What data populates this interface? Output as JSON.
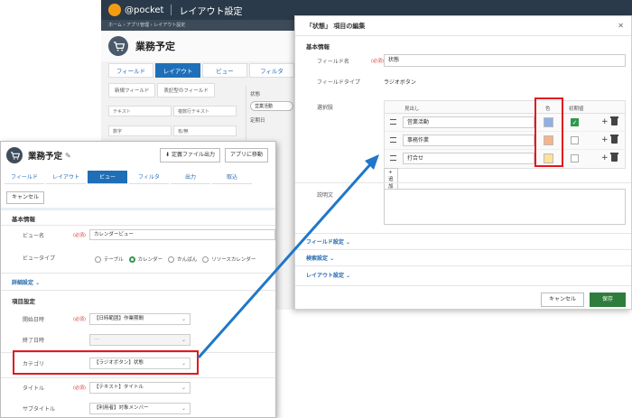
{
  "bg_app": {
    "logo": "@pocket",
    "title": "レイアウト設定",
    "breadcrumb": "ホーム › アプリ管理 › レイアウト設定",
    "page_title": "業務予定",
    "tabs": [
      "フィールド",
      "レイアウト",
      "ビュー",
      "フィルタ"
    ],
    "sub_tabs": [
      "新規フィールド",
      "表記型のフィールド"
    ],
    "palette": [
      "テキスト",
      "複数行テキスト",
      "数字",
      "有/無"
    ],
    "fields_label": "状態",
    "fields_pill": "営業活動",
    "fields_label2": "定期日"
  },
  "dialog": {
    "title": "「状態」 項目の編集",
    "sections": {
      "basic": "基本情報",
      "field_settings": "フィールド設定",
      "search_settings": "検索設定",
      "layout_settings": "レイアウト設定"
    },
    "labels": {
      "field_name": "フィールド名",
      "required": "(必須)",
      "field_type": "フィールドタイプ",
      "options": "選択肢",
      "description": "説明文"
    },
    "field_name_value": "状態",
    "field_type_value": "ラジオボタン",
    "table_headers": {
      "label": "見出し",
      "color": "色",
      "default": "初期値"
    },
    "options": [
      {
        "label": "営業活動",
        "color": "#8fb0e6",
        "default": true
      },
      {
        "label": "事務作業",
        "color": "#f5b48a",
        "default": false
      },
      {
        "label": "打合せ",
        "color": "#fbe19a",
        "default": false
      }
    ],
    "add_label": "+ 追加",
    "cancel_label": "キャンセル",
    "save_label": "保存"
  },
  "front": {
    "title": "業務予定",
    "btn_export": "定義ファイル出力",
    "btn_move": "アプリに移動",
    "tabs": [
      "フィールド",
      "レイアウト",
      "ビュー",
      "フィルタ",
      "出力",
      "取込"
    ],
    "cancel_label": "キャンセル",
    "sections": {
      "basic": "基本情報",
      "items": "項目設定"
    },
    "labels": {
      "view_name": "ビュー名",
      "view_type": "ビュータイプ",
      "start_date": "開始日時",
      "end_date": "終了日時",
      "category": "カテゴリ",
      "title": "タイトル",
      "subtitle": "サブタイトル",
      "required": "(必須)",
      "detail": "詳細設定"
    },
    "view_name_value": "カレンダービュー",
    "view_types": [
      "テーブル",
      "カレンダー",
      "かんばん",
      "リソースカレンダー"
    ],
    "start_value": "【日時範囲】作業期間",
    "end_value": "---",
    "category_value": "【ラジオボタン】状態",
    "title_value": "【テキスト】タイトル",
    "subtitle_value": "【利用者】対象メンバー"
  },
  "colors": {
    "accent_blue": "#1f6fb8",
    "save_green": "#2e7d3c",
    "highlight_red": "#e0191f"
  }
}
